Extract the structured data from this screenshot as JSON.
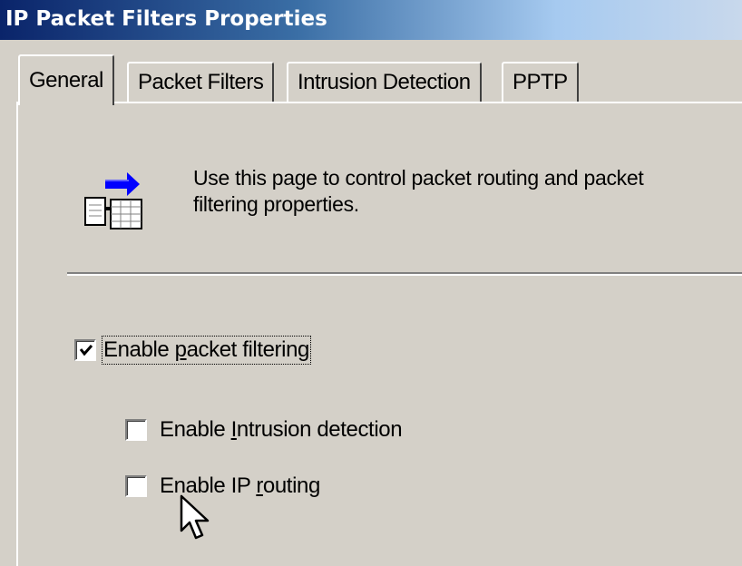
{
  "window": {
    "title": "IP Packet Filters Properties"
  },
  "tabs": [
    {
      "label": "General",
      "active": true
    },
    {
      "label": "Packet Filters",
      "active": false
    },
    {
      "label": "Intrusion Detection",
      "active": false
    },
    {
      "label": "PPTP",
      "active": false
    }
  ],
  "general": {
    "icon": "packet-filter-icon",
    "description_line1": "Use this page to control packet routing and packet",
    "description_line2": "filtering properties.",
    "checkboxes": {
      "enable_packet_filtering": {
        "label_pre": "Enable ",
        "label_accel": "p",
        "label_post": "acket filtering",
        "checked": true
      },
      "enable_intrusion_detection": {
        "label_pre": "Enable ",
        "label_accel": "I",
        "label_post": "ntrusion detection",
        "checked": false
      },
      "enable_ip_routing": {
        "label_pre": "Enable IP ",
        "label_accel": "r",
        "label_post": "outing",
        "checked": false
      }
    }
  },
  "colors": {
    "titlebar_start": "#0a246a",
    "titlebar_end": "#c8d8ec",
    "face": "#d4d0c8"
  }
}
